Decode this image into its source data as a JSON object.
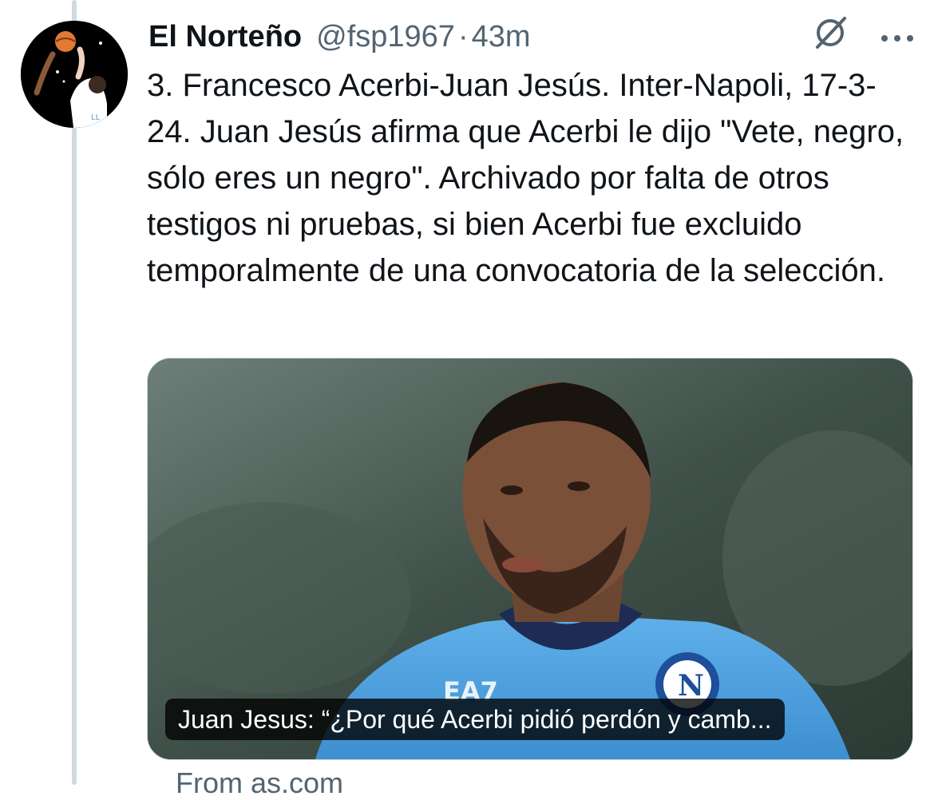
{
  "tweet": {
    "display_name": "El Norteño",
    "handle": "@fsp1967",
    "separator": "·",
    "time": "43m",
    "text": "3. Francesco Acerbi-Juan Jesús. Inter-Napoli, 17-3-24. Juan Jesús afirma que Acerbi le dijo \"Vete, negro, sólo eres un negro\". Archivado por falta de otros testigos ni pruebas, si bien Acerbi fue excluido temporalmente de una convocatoria de la selección.",
    "avatar_icon": "avatar-illustration-icon",
    "grok_icon": "grok-icon",
    "more_icon": "more-options-icon"
  },
  "link_card": {
    "caption": "Juan Jesus: “¿Por qué Acerbi pidió perdón y camb...",
    "source": "From as.com",
    "image_icon": "article-photo",
    "shirt_text": "EA7"
  },
  "colors": {
    "text_primary": "#0f1419",
    "text_secondary": "#536471",
    "thread_line": "#cfd9de",
    "caption_bg": "#000000"
  }
}
